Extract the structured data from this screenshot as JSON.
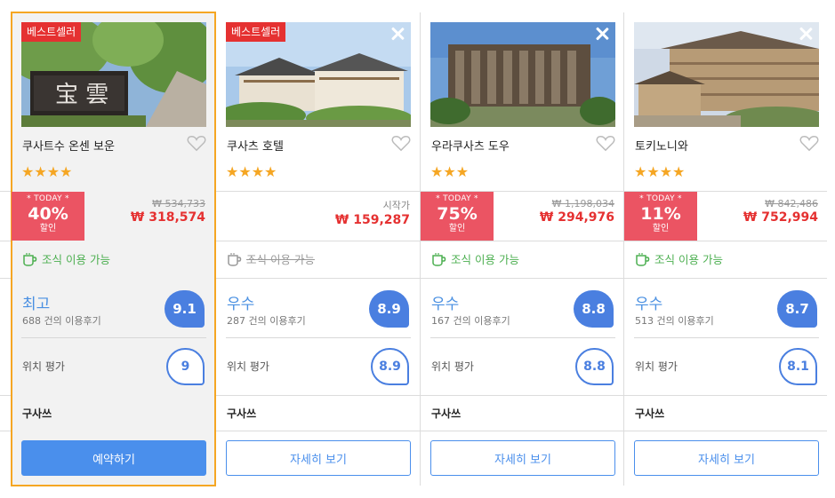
{
  "hotels": [
    {
      "badge": "베스트셀러",
      "name": "쿠사트수 온센 보운",
      "stars": "★★★★",
      "deal_today": "* TODAY *",
      "deal_percent": "40%",
      "deal_off": "할인",
      "price_old": "₩ 534,733",
      "price_new": "₩ 318,574",
      "breakfast": "조식 이용 가능",
      "rating_word": "최고",
      "review_count": "688 건의 이용후기",
      "score": "9.1",
      "location_label": "위치 평가",
      "location_score": "9",
      "area": "구사쓰",
      "button": "예약하기"
    },
    {
      "badge": "베스트셀러",
      "name": "쿠사츠 호텔",
      "stars": "★★★★",
      "from_label": "시작가",
      "price_new": "₩ 159,287",
      "breakfast": "조식 이용 가능",
      "rating_word": "우수",
      "review_count": "287 건의 이용후기",
      "score": "8.9",
      "location_label": "위치 평가",
      "location_score": "8.9",
      "area": "구사쓰",
      "button": "자세히 보기"
    },
    {
      "name": "우라쿠사츠 도우",
      "stars": "★★★",
      "deal_today": "* TODAY *",
      "deal_percent": "75%",
      "deal_off": "할인",
      "price_old": "₩ 1,198,034",
      "price_new": "₩ 294,976",
      "breakfast": "조식 이용 가능",
      "rating_word": "우수",
      "review_count": "167 건의 이용후기",
      "score": "8.8",
      "location_label": "위치 평가",
      "location_score": "8.8",
      "area": "구사쓰",
      "button": "자세히 보기"
    },
    {
      "name": "토키노니와",
      "stars": "★★★★",
      "deal_today": "* TODAY *",
      "deal_percent": "11%",
      "deal_off": "할인",
      "price_old": "₩ 842,486",
      "price_new": "₩ 752,994",
      "breakfast": "조식 이용 가능",
      "rating_word": "우수",
      "review_count": "513 건의 이용후기",
      "score": "8.7",
      "location_label": "위치 평가",
      "location_score": "8.1",
      "area": "구사쓰",
      "button": "자세히 보기"
    }
  ],
  "colors": {
    "accent_blue": "#4a8fec",
    "deal_red": "#eb5463",
    "price_red": "#e53131",
    "star_orange": "#f5a623",
    "featured_border": "#f5a623",
    "breakfast_green": "#4caf50"
  }
}
